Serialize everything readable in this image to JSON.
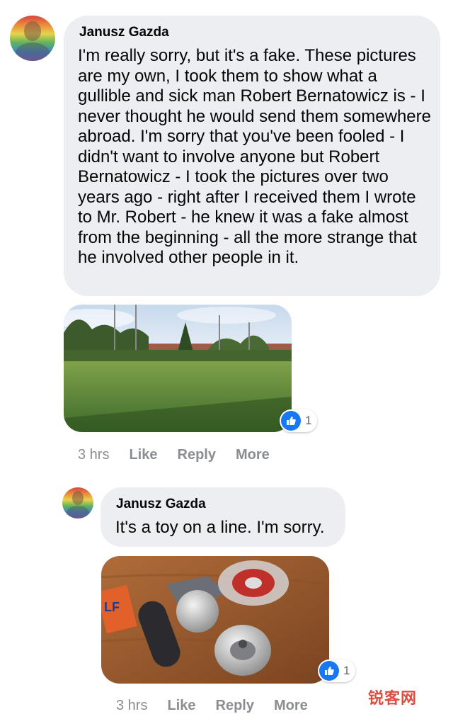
{
  "comment1": {
    "author": "Janusz Gazda",
    "text": "I'm really sorry, but it's a fake. These pictures are my own, I took them to show what a gullible and sick man Robert Bernatowicz is - I never thought he would send them somewhere abroad. I'm sorry that you've been fooled - I didn't want to involve anyone but Robert Bernatowicz - I took the pictures over two years ago - right after I received them I wrote to Mr. Robert - he knew it was a fake almost from the beginning - all the more strange that he involved other people in it.",
    "reaction_count": "1",
    "actions": {
      "time": "3 hrs",
      "like": "Like",
      "reply": "Reply",
      "more": "More"
    }
  },
  "comment2": {
    "author": "Janusz Gazda",
    "text": "It's a toy on a line. I'm sorry.",
    "reaction_count": "1",
    "actions": {
      "time": "3 hrs",
      "like": "Like",
      "reply": "Reply",
      "more": "More"
    }
  },
  "watermark": {
    "text": "锐客网"
  },
  "colors": {
    "bubble": "#eceef1",
    "like_blue": "#1877f2",
    "meta_gray": "#8a8d91"
  }
}
